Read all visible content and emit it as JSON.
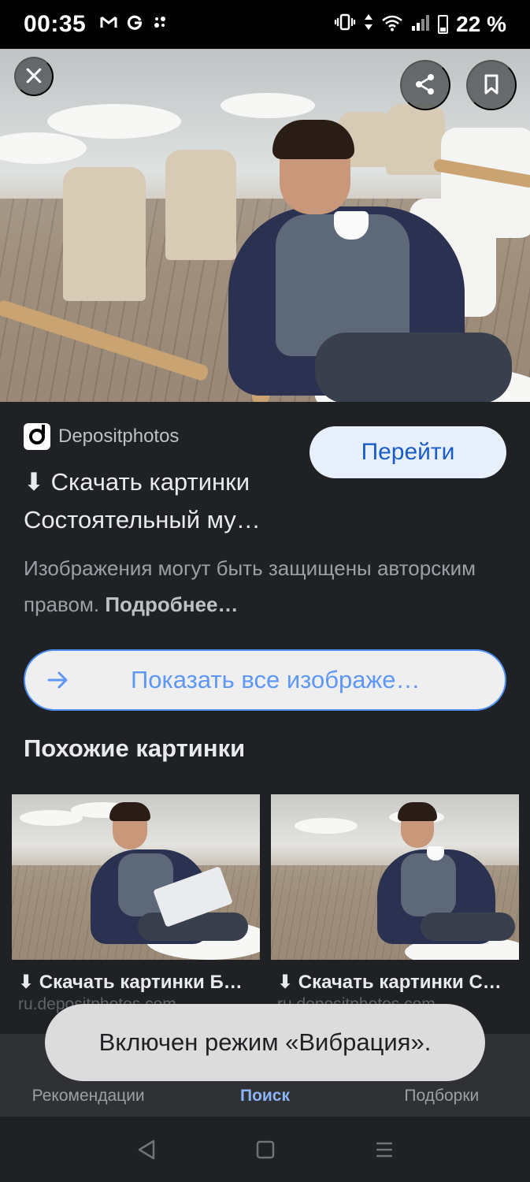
{
  "status_bar": {
    "time": "00:35",
    "left_icons": [
      "gmail-icon",
      "google-icon",
      "fan-icon"
    ],
    "battery_percent": "22 %"
  },
  "hero": {
    "close_icon": "close-icon",
    "share_icon": "share-icon",
    "bookmark_icon": "bookmark-icon"
  },
  "result": {
    "source_name": "Depositphotos",
    "go_button": "Перейти",
    "title_line1": "⬇ Скачать картинки",
    "title_line2": "Состоятельный му…",
    "copyright_text": "Изображения могут быть защищены авторским правом.",
    "copyright_more": "Подробнее…",
    "show_all": "Показать все изображе…"
  },
  "similar": {
    "heading": "Похожие картинки",
    "items": [
      {
        "title": "⬇ Скачать картинки Б…",
        "domain": "ru.depositphotos.com"
      },
      {
        "title": "⬇ Скачать картинки С…",
        "domain": "ru.depositphotos.com"
      }
    ]
  },
  "bottom_nav": {
    "items": [
      {
        "label": "Рекомендации",
        "icon": "asterisk-icon"
      },
      {
        "label": "Поиск",
        "icon": "search-icon"
      },
      {
        "label": "Подборки",
        "icon": "bookmark-icon"
      }
    ],
    "active_index": 1
  },
  "toast": {
    "text": "Включен режим «Вибрация»."
  },
  "colors": {
    "background": "#202124",
    "accent": "#8ab4f8",
    "button_bg": "#e8f0fe",
    "button_text": "#1a5cc8",
    "outline": "#4d8ff5",
    "toast_bg": "#dcdcdc"
  }
}
